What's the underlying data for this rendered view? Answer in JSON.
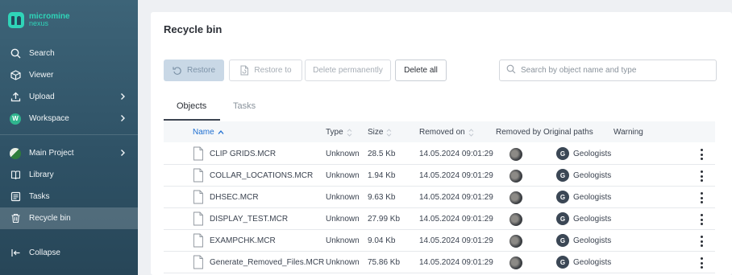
{
  "app": {
    "brand": "micromine",
    "brand_sub": "nexus"
  },
  "sidebar": {
    "items": [
      {
        "label": "Search",
        "icon": "search-icon"
      },
      {
        "label": "Viewer",
        "icon": "cube-icon"
      },
      {
        "label": "Upload",
        "icon": "upload-icon"
      },
      {
        "label": "Workspace",
        "icon": "workspace-badge",
        "badge": "W"
      },
      {
        "label": "Main Project",
        "icon": "project-badge"
      },
      {
        "label": "Library",
        "icon": "library-icon"
      },
      {
        "label": "Tasks",
        "icon": "tasks-icon"
      },
      {
        "label": "Recycle bin",
        "icon": "trash-icon"
      }
    ],
    "collapse_label": "Collapse"
  },
  "main": {
    "title": "Recycle bin",
    "toolbar": {
      "restore": "Restore",
      "restore_to": "Restore to",
      "delete_permanently": "Delete permanently",
      "delete_all": "Delete all"
    },
    "search": {
      "placeholder": "Search by object name and type",
      "value": ""
    },
    "tabs": [
      "Objects",
      "Tasks"
    ],
    "active_tab": "Objects",
    "columns": {
      "name": "Name",
      "type": "Type",
      "size": "Size",
      "removed_on": "Removed on",
      "removed_by": "Removed by",
      "original_paths": "Original paths",
      "warning": "Warning"
    },
    "rows": [
      {
        "name": "CLIP GRIDS.MCR",
        "type": "Unknown",
        "size": "28.5 Kb",
        "removed_on": "14.05.2024 09:01:29",
        "path_badge": "G",
        "path": "Geologists"
      },
      {
        "name": "COLLAR_LOCATIONS.MCR",
        "type": "Unknown",
        "size": "1.94 Kb",
        "removed_on": "14.05.2024 09:01:29",
        "path_badge": "G",
        "path": "Geologists"
      },
      {
        "name": "DHSEC.MCR",
        "type": "Unknown",
        "size": "9.63 Kb",
        "removed_on": "14.05.2024 09:01:29",
        "path_badge": "G",
        "path": "Geologists"
      },
      {
        "name": "DISPLAY_TEST.MCR",
        "type": "Unknown",
        "size": "27.99 Kb",
        "removed_on": "14.05.2024 09:01:29",
        "path_badge": "G",
        "path": "Geologists"
      },
      {
        "name": "EXAMPCHK.MCR",
        "type": "Unknown",
        "size": "9.04 Kb",
        "removed_on": "14.05.2024 09:01:29",
        "path_badge": "G",
        "path": "Geologists"
      },
      {
        "name": "Generate_Removed_Files.MCR",
        "type": "Unknown",
        "size": "75.86 Kb",
        "removed_on": "14.05.2024 09:01:29",
        "path_badge": "G",
        "path": "Geologists"
      }
    ]
  },
  "colors": {
    "accent": "#2fd4b8",
    "sidebar": "#2f5266",
    "link": "#1f6fd1"
  }
}
